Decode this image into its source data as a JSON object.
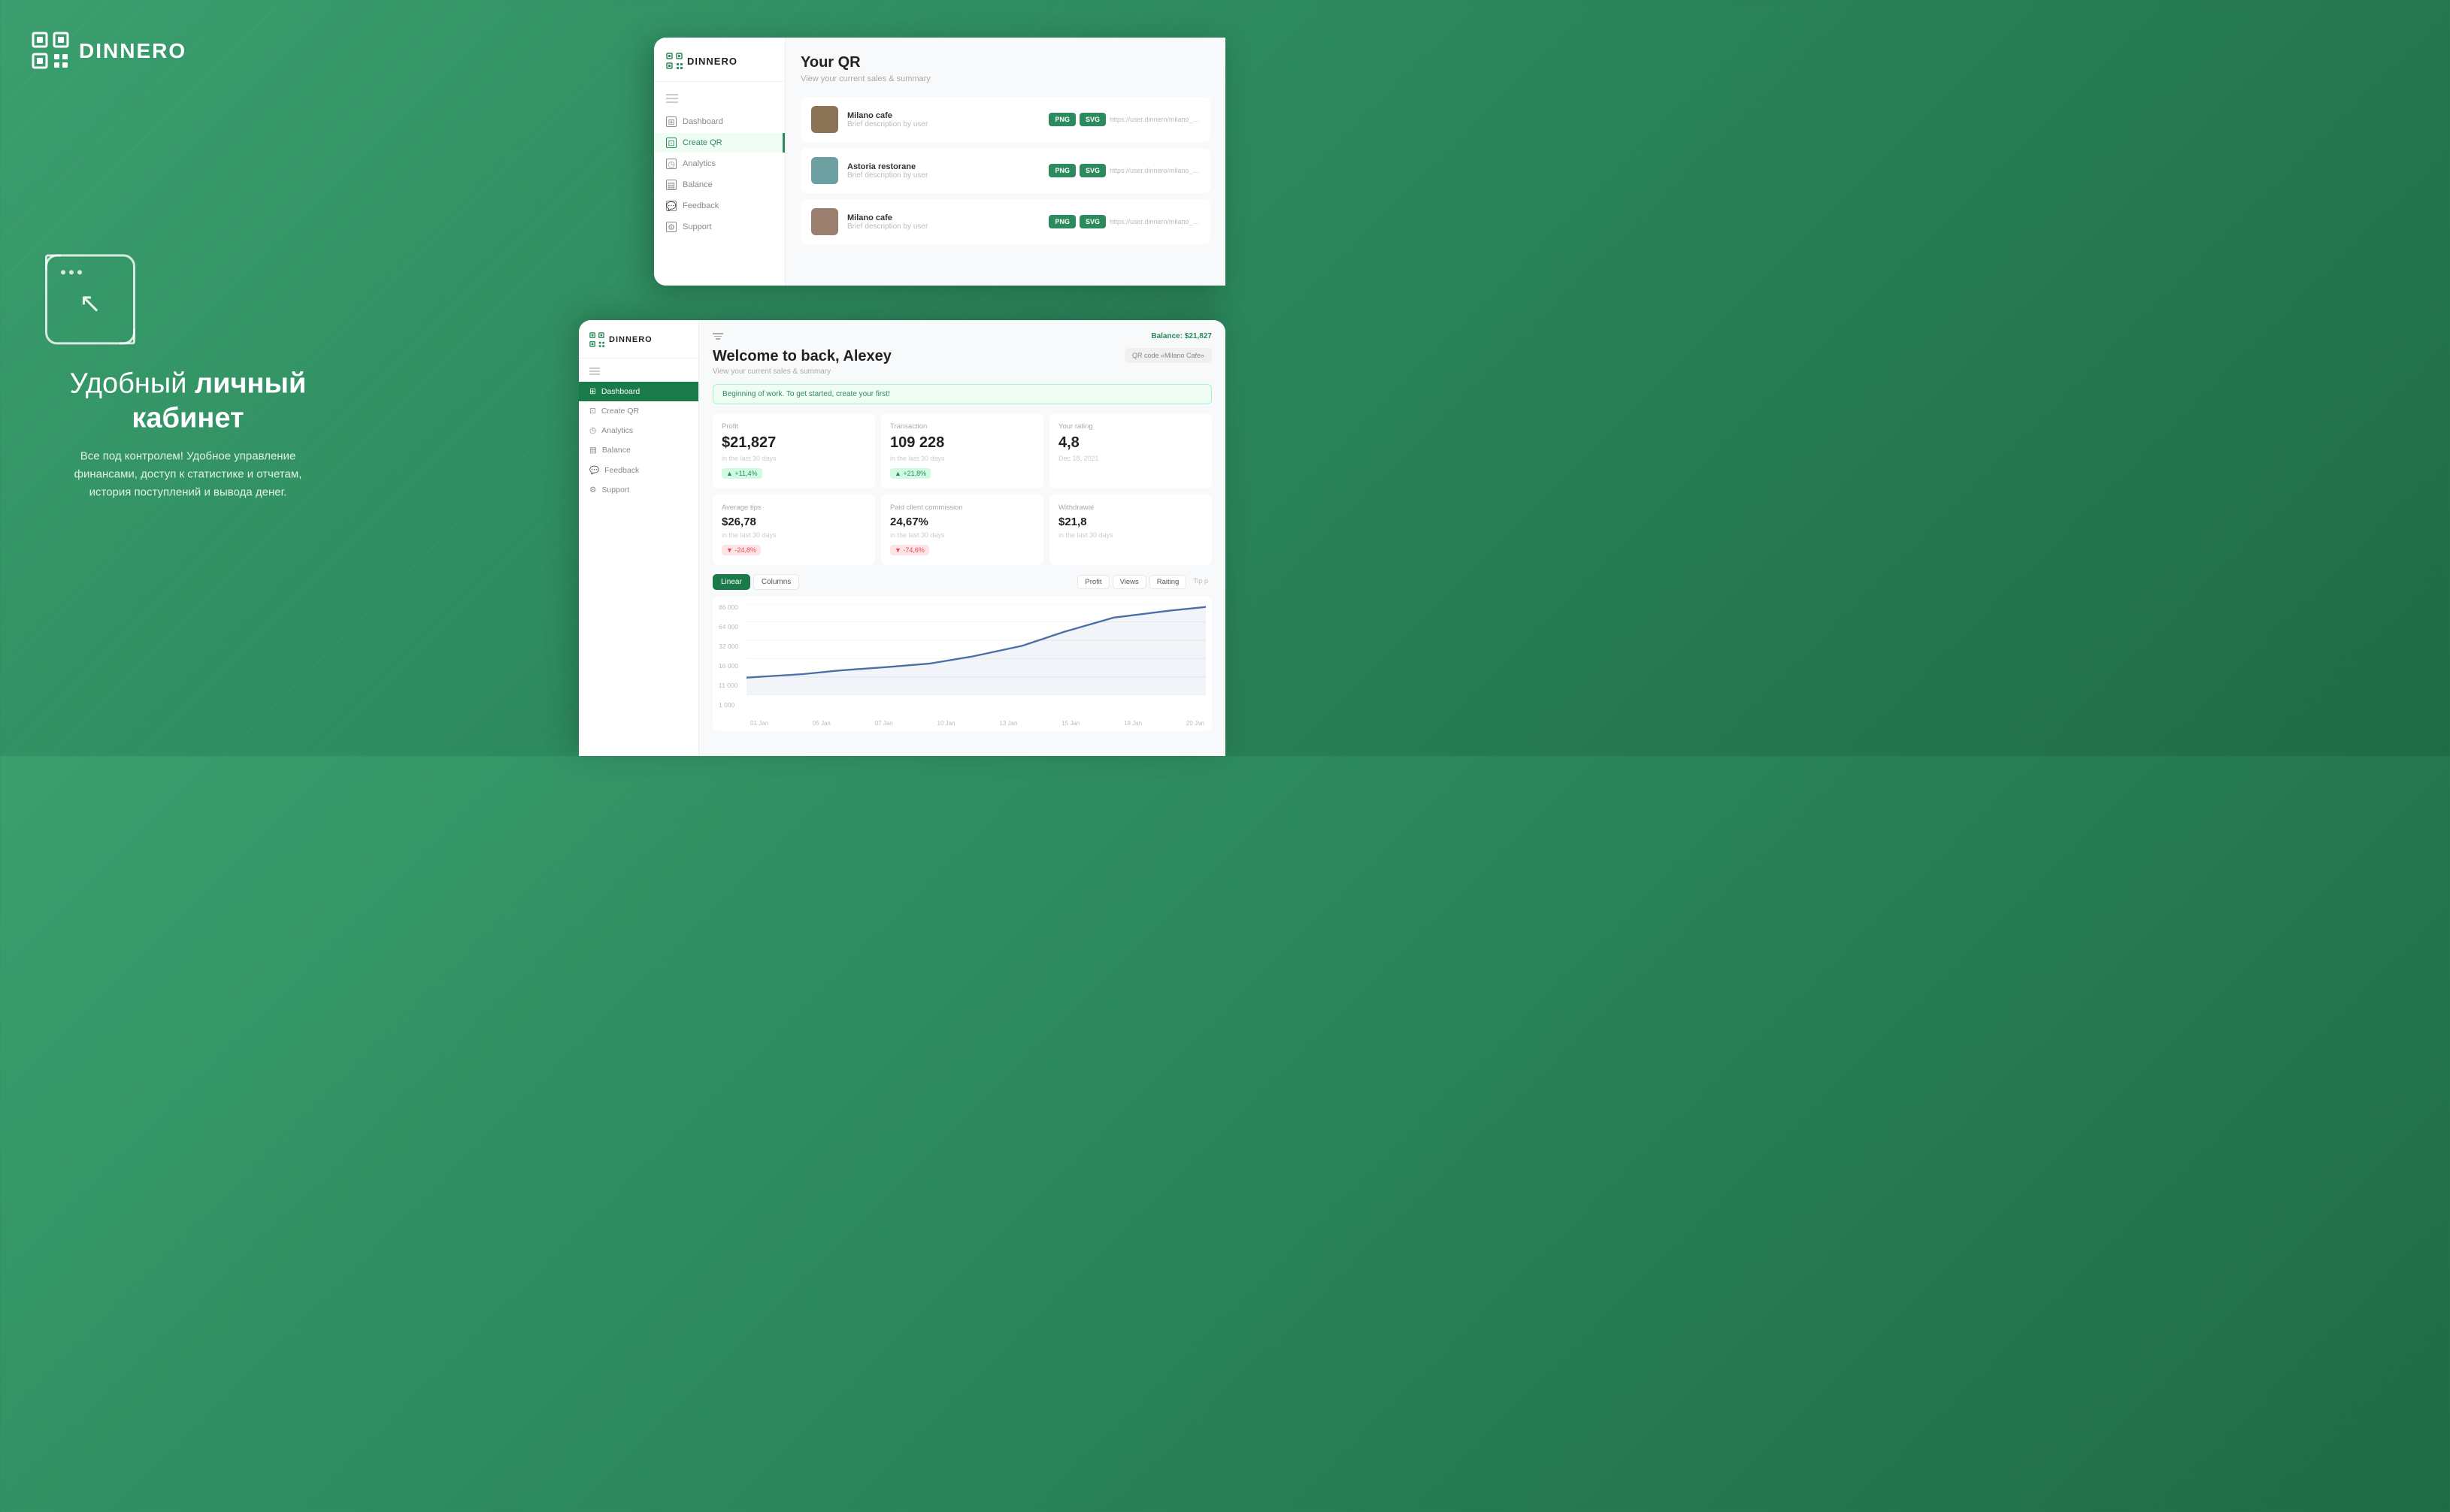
{
  "brand": {
    "name": "DINNERO",
    "logo_alt": "Dinnero logo"
  },
  "hero": {
    "headline_normal": "Удобный",
    "headline_bold": "личный кабинет",
    "subtext": "Все под контролем! Удобное управление\nфинансами, доступ к статистике и отчетам,\nистория поступлений и вывода денег."
  },
  "window_qr": {
    "title": "Your QR",
    "subtitle": "View your current sales & summary",
    "rows": [
      {
        "name": "Milano cafe",
        "desc": "Brief description by user",
        "url": "https://user.dinnero/milano_cafe",
        "btn1": "PNG",
        "btn2": "SVG"
      },
      {
        "name": "Astoria restorane",
        "desc": "Brief description by user",
        "url": "https://user.dinnero/milano_cafe",
        "btn1": "PNG",
        "btn2": "SVG"
      },
      {
        "name": "Milano cafe",
        "desc": "Brief description by user",
        "url": "https://user.dinnero/milano_cafe",
        "btn1": "PNG",
        "btn2": "SVG"
      }
    ],
    "sidebar": {
      "items": [
        {
          "label": "Dashboard",
          "icon": "dashboard",
          "active": false
        },
        {
          "label": "Create QR",
          "icon": "qr",
          "active": true
        },
        {
          "label": "Analytics",
          "icon": "analytics",
          "active": false
        },
        {
          "label": "Balance",
          "icon": "balance",
          "active": false
        },
        {
          "label": "Feedback",
          "icon": "feedback",
          "active": false
        },
        {
          "label": "Support",
          "icon": "support",
          "active": false
        }
      ]
    }
  },
  "window_dash": {
    "balance_label": "Balance:",
    "balance_value": "$21,827",
    "welcome": "Welcome to back, Alexey",
    "subtitle": "View your current sales & summary",
    "banner": "Beginning of work. To get started, create your first!",
    "qr_badge": "QR code «Milano Cafe»",
    "stats": [
      {
        "label": "Profit",
        "value": "$21,827",
        "sub": "in the last 30 days",
        "badge": "+11,4%",
        "trend": "up"
      },
      {
        "label": "Transaction",
        "value": "109 228",
        "sub": "in the last 30 days",
        "badge": "+21,8%",
        "trend": "up"
      },
      {
        "label": "Your rating",
        "value": "4,8",
        "sub": "Dec 18, 2021",
        "badge": "",
        "trend": ""
      },
      {
        "label": "Average tips",
        "value": "$26,78",
        "sub": "in the last 30 days",
        "badge": "-24,8%",
        "trend": "down"
      },
      {
        "label": "Paid client commission",
        "value": "24,67%",
        "sub": "in the last 30 days",
        "badge": "-74,6%",
        "trend": "down"
      },
      {
        "label": "Withdrawal",
        "value": "$21,8",
        "sub": "in the last 30 days",
        "badge": "",
        "trend": ""
      }
    ],
    "chart": {
      "type_buttons": [
        "Linear",
        "Columns"
      ],
      "active_type": "Linear",
      "metric_buttons": [
        "Profit",
        "Views",
        "Raiting"
      ],
      "y_labels": [
        "86 000",
        "64 000",
        "32 000",
        "16 000",
        "11 000",
        "1 000"
      ],
      "x_labels": [
        "01 Jan",
        "05 Jan",
        "07 Jan",
        "10 Jan",
        "13 Jan",
        "15 Jan",
        "18 Jan",
        "20 Jan"
      ]
    },
    "sidebar": {
      "items": [
        {
          "label": "Dashboard",
          "icon": "dashboard",
          "active": true
        },
        {
          "label": "Create QR",
          "icon": "qr",
          "active": false
        },
        {
          "label": "Analytics",
          "icon": "analytics",
          "active": false
        },
        {
          "label": "Balance",
          "icon": "balance",
          "active": false
        },
        {
          "label": "Feedback",
          "icon": "feedback",
          "active": false
        },
        {
          "label": "Support",
          "icon": "support",
          "active": false
        }
      ]
    }
  }
}
